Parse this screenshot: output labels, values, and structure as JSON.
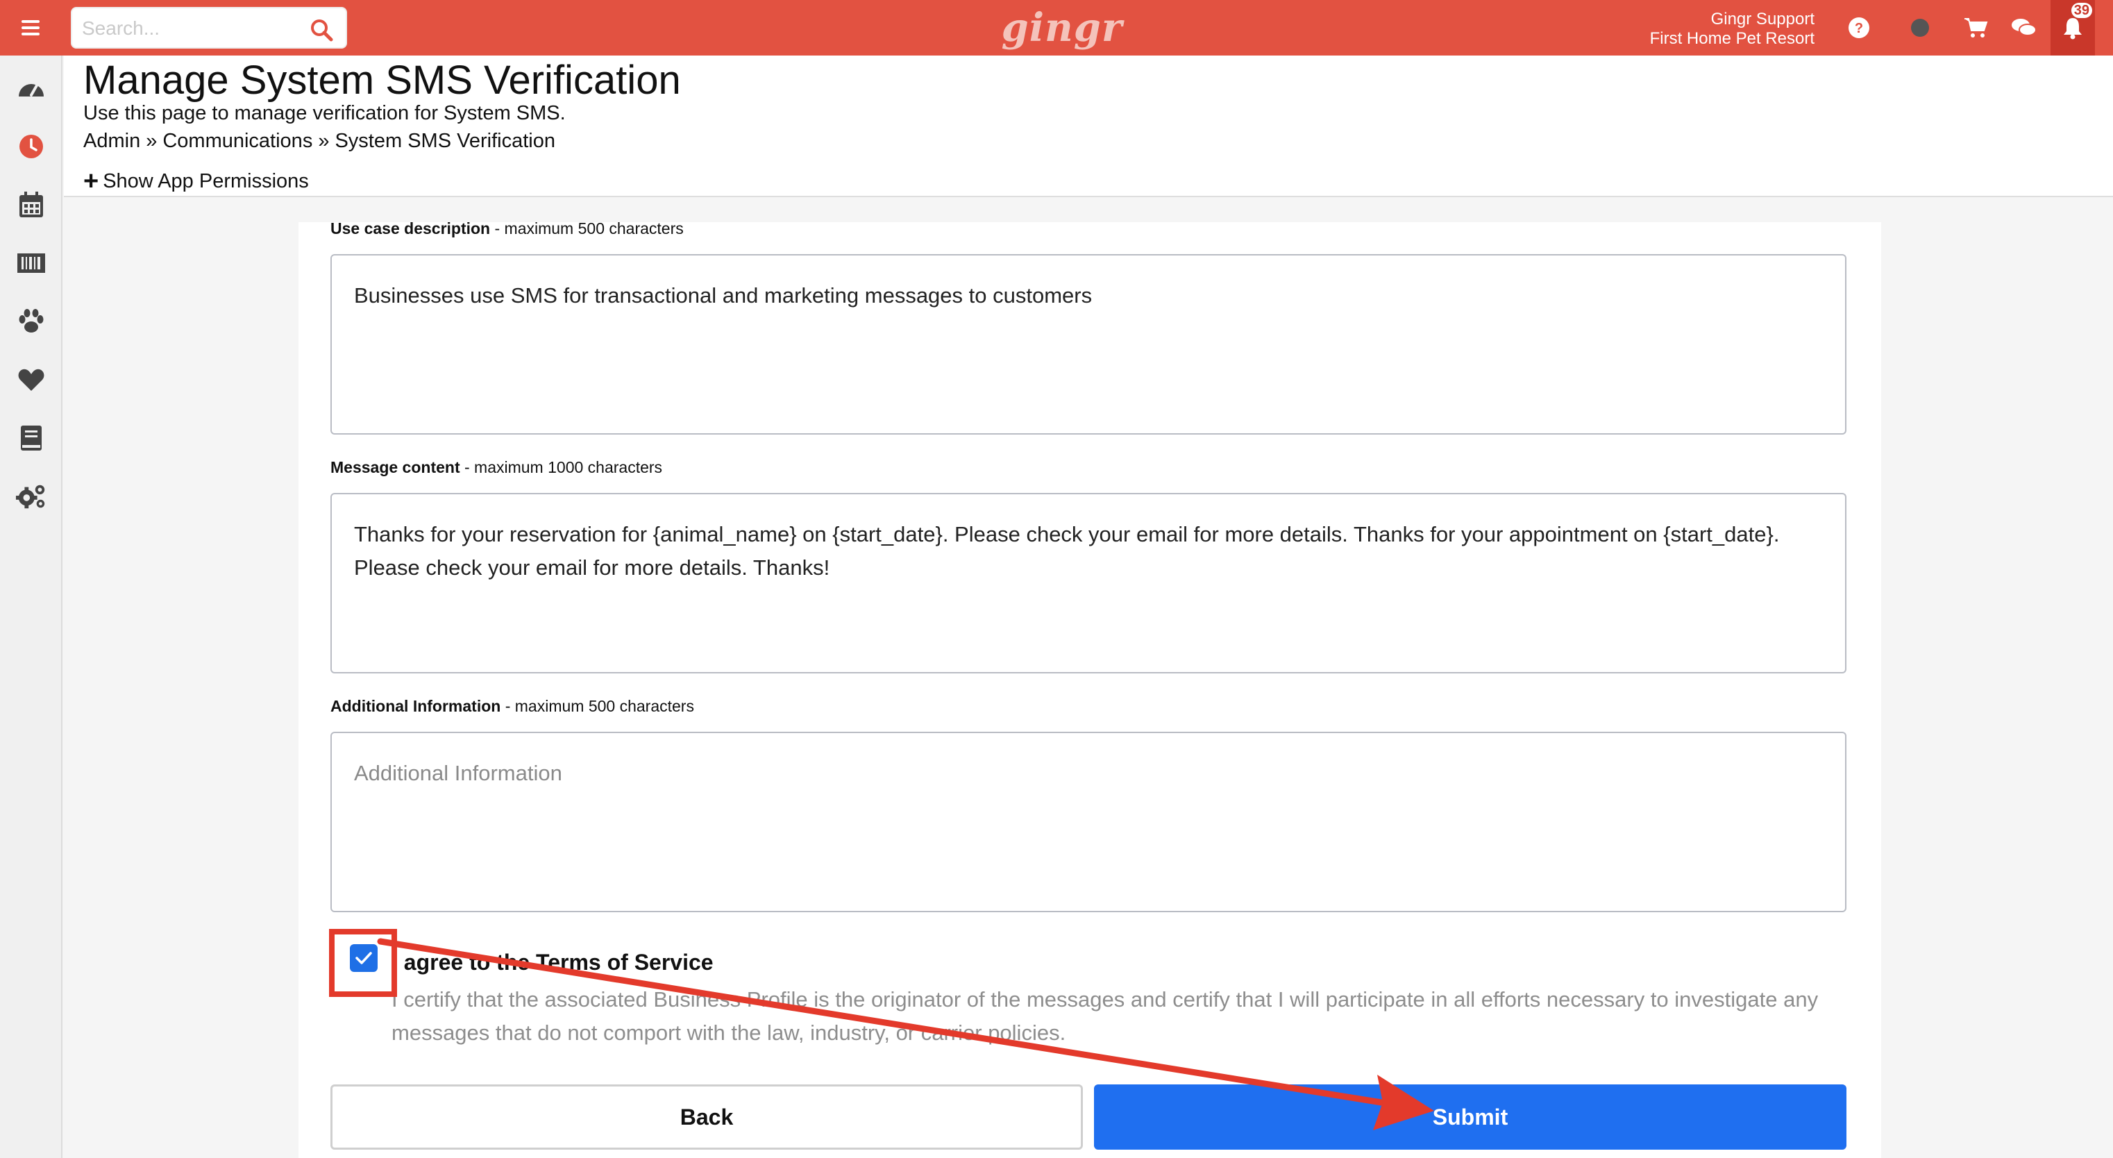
{
  "topbar": {
    "search_placeholder": "Search...",
    "logo_text": "gingr",
    "user_name": "Gingr Support",
    "location": "First Home Pet Resort",
    "notification_count": "39"
  },
  "sidebar": {
    "items": [
      {
        "icon": "dashboard-gauge-icon"
      },
      {
        "icon": "clock-icon"
      },
      {
        "icon": "calendar-icon"
      },
      {
        "icon": "barcode-icon"
      },
      {
        "icon": "paw-icon"
      },
      {
        "icon": "heart-icon"
      },
      {
        "icon": "book-icon"
      },
      {
        "icon": "gears-icon"
      }
    ]
  },
  "header": {
    "title": "Manage System SMS Verification",
    "description": "Use this page to manage verification for System SMS.",
    "breadcrumb": [
      "Admin",
      "Communications",
      "System SMS Verification"
    ],
    "breadcrumb_sep": "»",
    "permissions_toggle": "Show App Permissions"
  },
  "form": {
    "use_case": {
      "label": "Use case description",
      "hint": " - maximum 500 characters",
      "value": "Businesses use SMS for transactional and marketing messages to customers"
    },
    "message_content": {
      "label": "Message content",
      "hint": " - maximum 1000 characters",
      "value": "Thanks for your reservation for {animal_name} on {start_date}. Please check your email for more details. Thanks for your appointment on {start_date}. Please check your email for more details. Thanks!"
    },
    "additional_info": {
      "label": "Additional Information",
      "hint": " - maximum 500 characters",
      "value": "",
      "placeholder": "Additional Information"
    },
    "terms": {
      "checked": true,
      "title": "I agree to the Terms of Service",
      "text": "I certify that the associated Business Profile is the originator of the messages and certify that I will participate in all efforts necessary to investigate any messages that do not comport with the law, industry, or carrier policies."
    },
    "back_label": "Back",
    "submit_label": "Submit"
  },
  "colors": {
    "brand": "#e25241",
    "primary_button": "#1f6ff0",
    "annotation": "#e33a2b"
  }
}
